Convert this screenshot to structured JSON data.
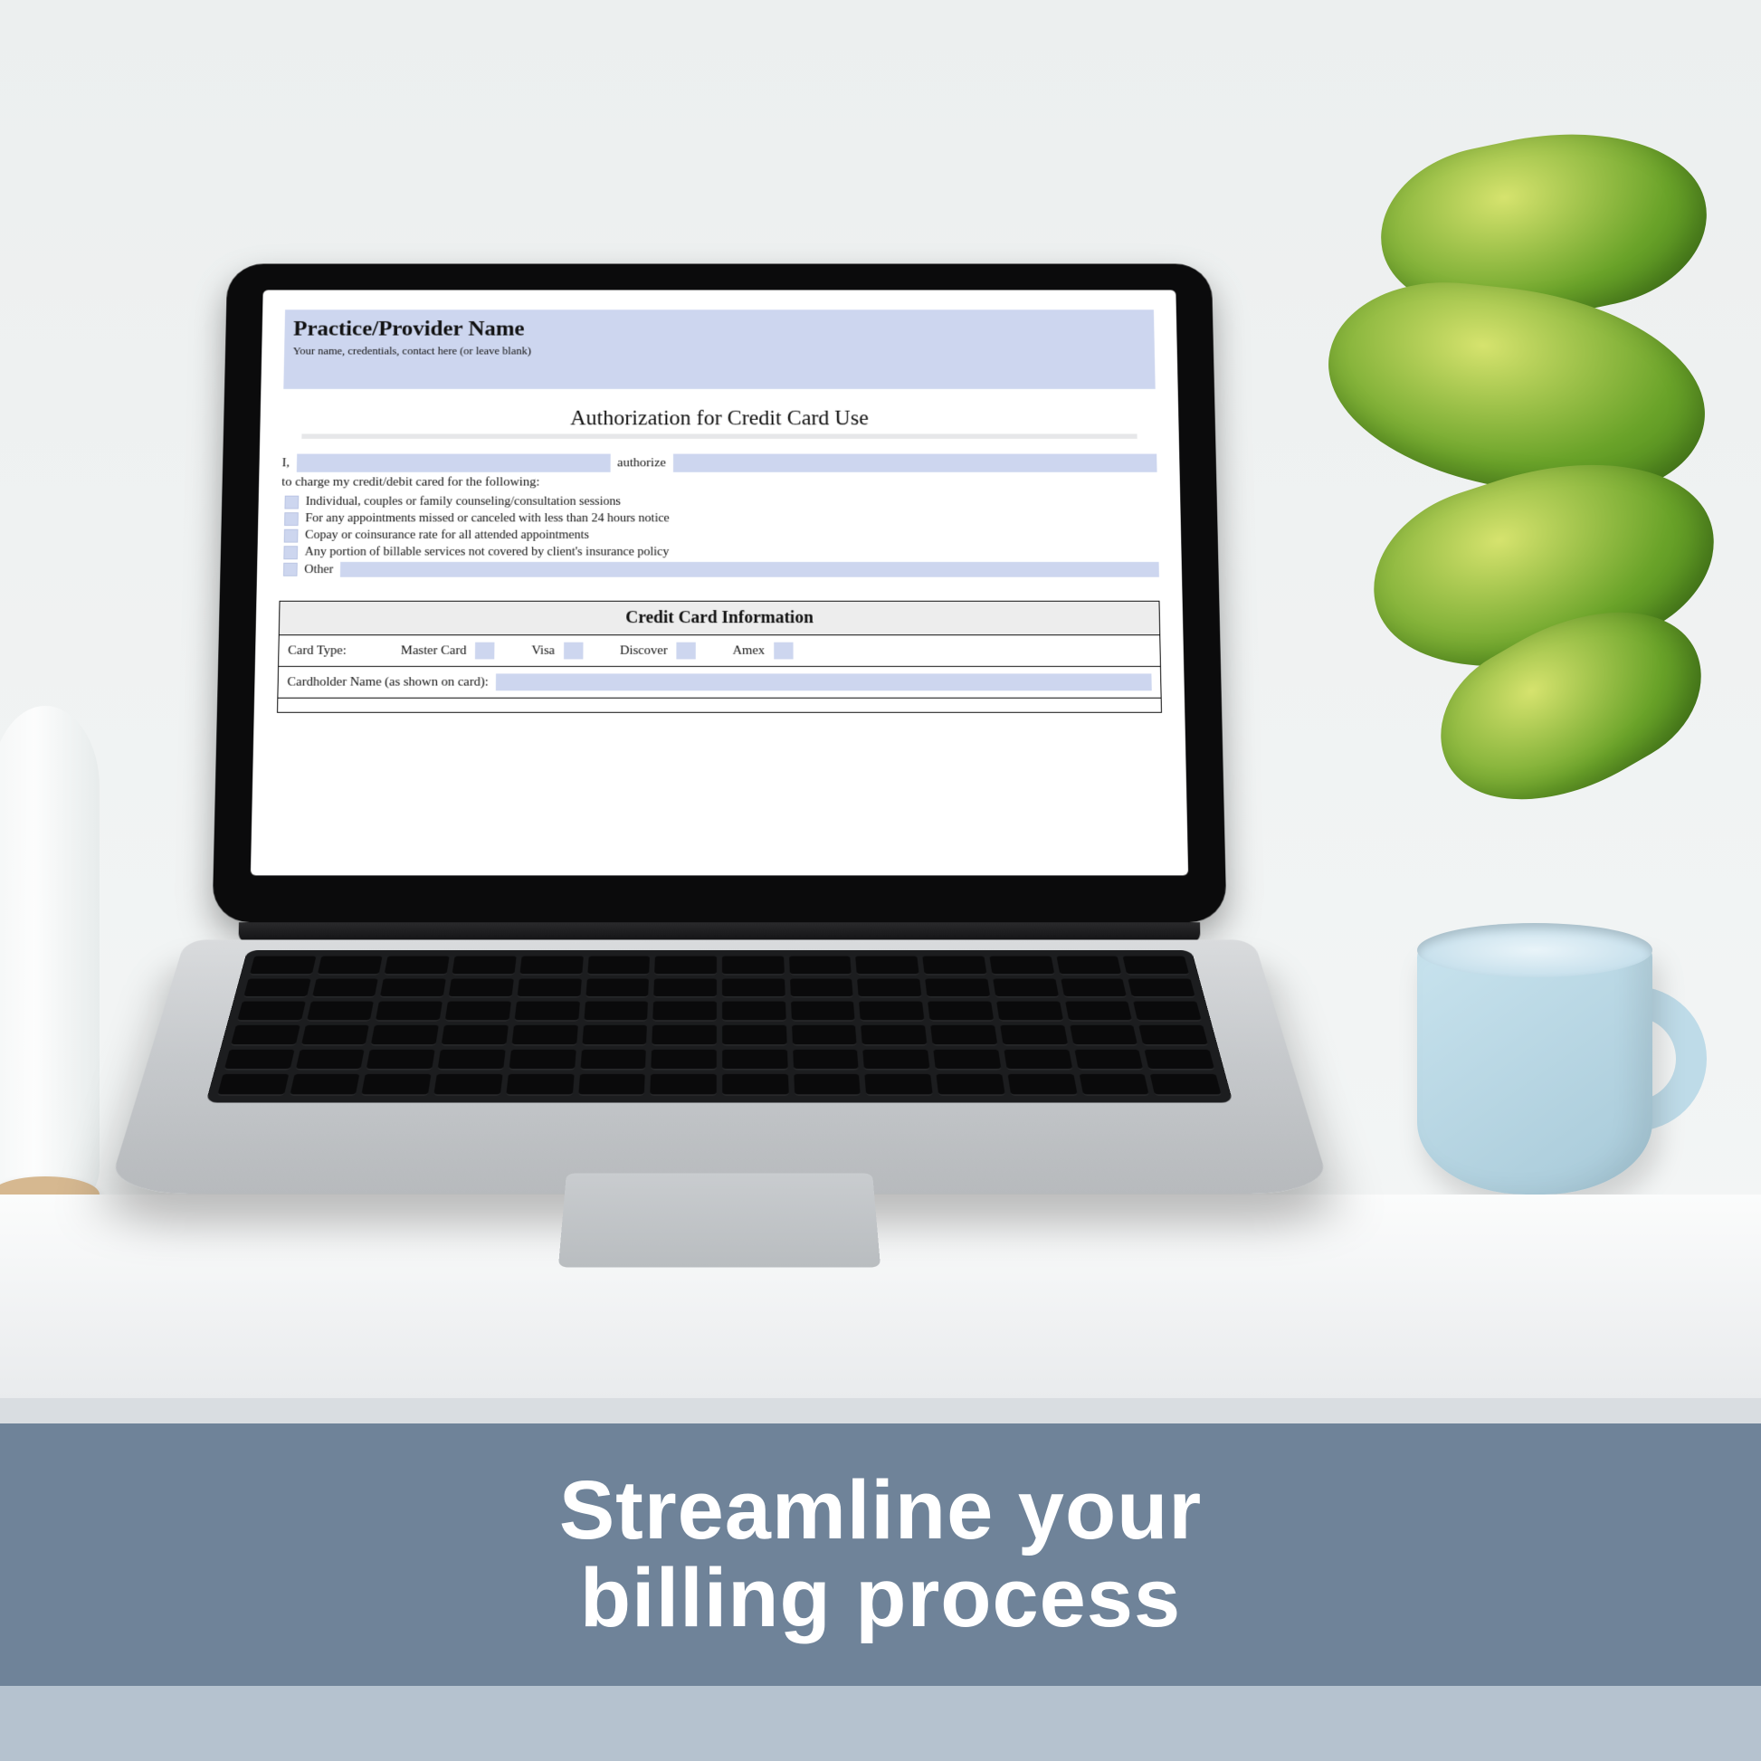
{
  "banner": {
    "line1": "Streamline your",
    "line2": "billing process"
  },
  "doc": {
    "header_title": "Practice/Provider Name",
    "header_sub": "Your name, credentials, contact here (or leave blank)",
    "title": "Authorization for Credit Card Use",
    "auth_prefix": "I,",
    "auth_mid": "authorize",
    "auth_sentence": "to charge my credit/debit cared for the following:",
    "checks": [
      "Individual, couples or family counseling/consultation sessions",
      "For any appointments missed or canceled with less than 24 hours notice",
      "Copay or coinsurance rate for all attended appointments",
      "Any portion of billable services not covered by client's insurance policy"
    ],
    "other_label": "Other",
    "cc_header": "Credit Card Information",
    "card_type_label": "Card Type:",
    "card_options": [
      "Master Card",
      "Visa",
      "Discover",
      "Amex"
    ],
    "cardholder_label": "Cardholder Name (as shown on card):"
  }
}
